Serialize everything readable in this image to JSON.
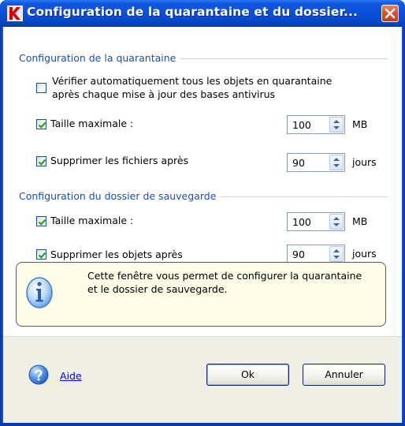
{
  "window": {
    "title": "Configuration de la quarantaine et du dossier..."
  },
  "quarantine": {
    "group_title": "Configuration de la quarantaine",
    "auto_scan": {
      "checked": false,
      "label_line1": "Vérifier automatiquement tous les objets en quarantaine",
      "label_line2": "après chaque mise à jour des bases antivirus"
    },
    "max_size": {
      "checked": true,
      "label": "Taille maximale :",
      "value": "100",
      "unit": "MB"
    },
    "delete_after": {
      "checked": true,
      "label": "Supprimer les fichiers après",
      "value": "90",
      "unit": "jours"
    }
  },
  "backup": {
    "group_title": "Configuration du dossier de sauvegarde",
    "max_size": {
      "checked": true,
      "label": "Taille maximale :",
      "value": "100",
      "unit": "MB"
    },
    "delete_after": {
      "checked": true,
      "label": "Supprimer les objets après",
      "value": "90",
      "unit": "jours"
    }
  },
  "info": {
    "text_line1": "Cette fenêtre vous permet de configurer la quarantaine",
    "text_line2": "et le dossier de sauvegarde.",
    "icon": "info-icon"
  },
  "footer": {
    "help_label": "Aide",
    "ok_label": "Ok",
    "cancel_label": "Annuler"
  },
  "colors": {
    "title_bar": "#0a4fd8",
    "group_title": "#1e4ea8",
    "checkmark": "#21a121",
    "info_background": "#fefbe6",
    "close_button": "#d9522b"
  }
}
